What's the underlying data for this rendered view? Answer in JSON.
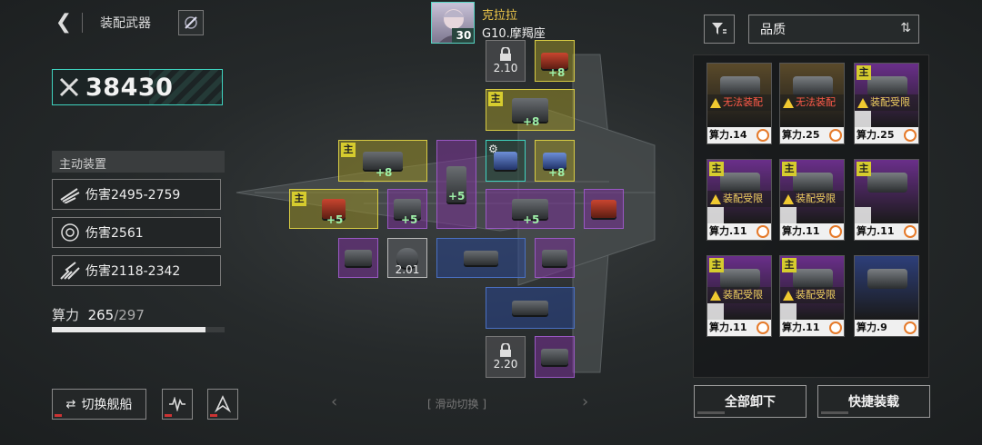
{
  "header": {
    "title": "装配武器",
    "back_icon": "chevron-left-icon",
    "rocket_icon": "rocket-icon"
  },
  "player": {
    "name": "克拉拉",
    "level": "30",
    "ship": "G10.摩羯座"
  },
  "combat_power": "38430",
  "active_skills": {
    "heading": "主动装置",
    "items": [
      {
        "icon": "missile-icon",
        "text": "伤害2495-2759"
      },
      {
        "icon": "shield-ring-icon",
        "text": "伤害2561"
      },
      {
        "icon": "strike-icon",
        "text": "伤害2118-2342"
      }
    ]
  },
  "capacity": {
    "label": "算力",
    "current": "265",
    "max": "/297",
    "fraction": 0.892
  },
  "bottom_left": {
    "switch_ship": "切换舰船",
    "icon_a": "waveform-icon",
    "icon_b": "trident-icon"
  },
  "slots": {
    "lock_top": "2.10",
    "lock_bottom": "2.20",
    "lock_mid": "2.01",
    "main_tag": "主",
    "plus8": "+8",
    "plus5": "+5"
  },
  "swipe": {
    "label": "滑动切换",
    "left": "‹",
    "right": "›"
  },
  "right_panel": {
    "filter_icon": "filter-icon",
    "sort_label": "品质",
    "sort_icon": "sort-arrows-icon",
    "cards": [
      {
        "power": "算力.14",
        "status": "无法装配",
        "main": false,
        "color": "#5a4a2a"
      },
      {
        "power": "算力.25",
        "status": "无法装配",
        "main": false,
        "color": "#5a4a2a"
      },
      {
        "power": "算力.25",
        "status": "装配受限",
        "main": true,
        "color": "#6a2f8a"
      },
      {
        "power": "算力.11",
        "status": "装配受限",
        "main": true,
        "color": "#6a2f8a"
      },
      {
        "power": "算力.11",
        "status": "装配受限",
        "main": true,
        "color": "#6a2f8a"
      },
      {
        "power": "算力.11",
        "status": "",
        "main": true,
        "color": "#6a2f8a"
      },
      {
        "power": "算力.11",
        "status": "装配受限",
        "main": true,
        "color": "#6a2f8a"
      },
      {
        "power": "算力.11",
        "status": "装配受限",
        "main": true,
        "color": "#6a2f8a"
      },
      {
        "power": "算力.9",
        "status": "",
        "main": false,
        "color": "#2d3f7a"
      }
    ],
    "unequip_all": "全部卸下",
    "quick_equip": "快捷装载"
  }
}
